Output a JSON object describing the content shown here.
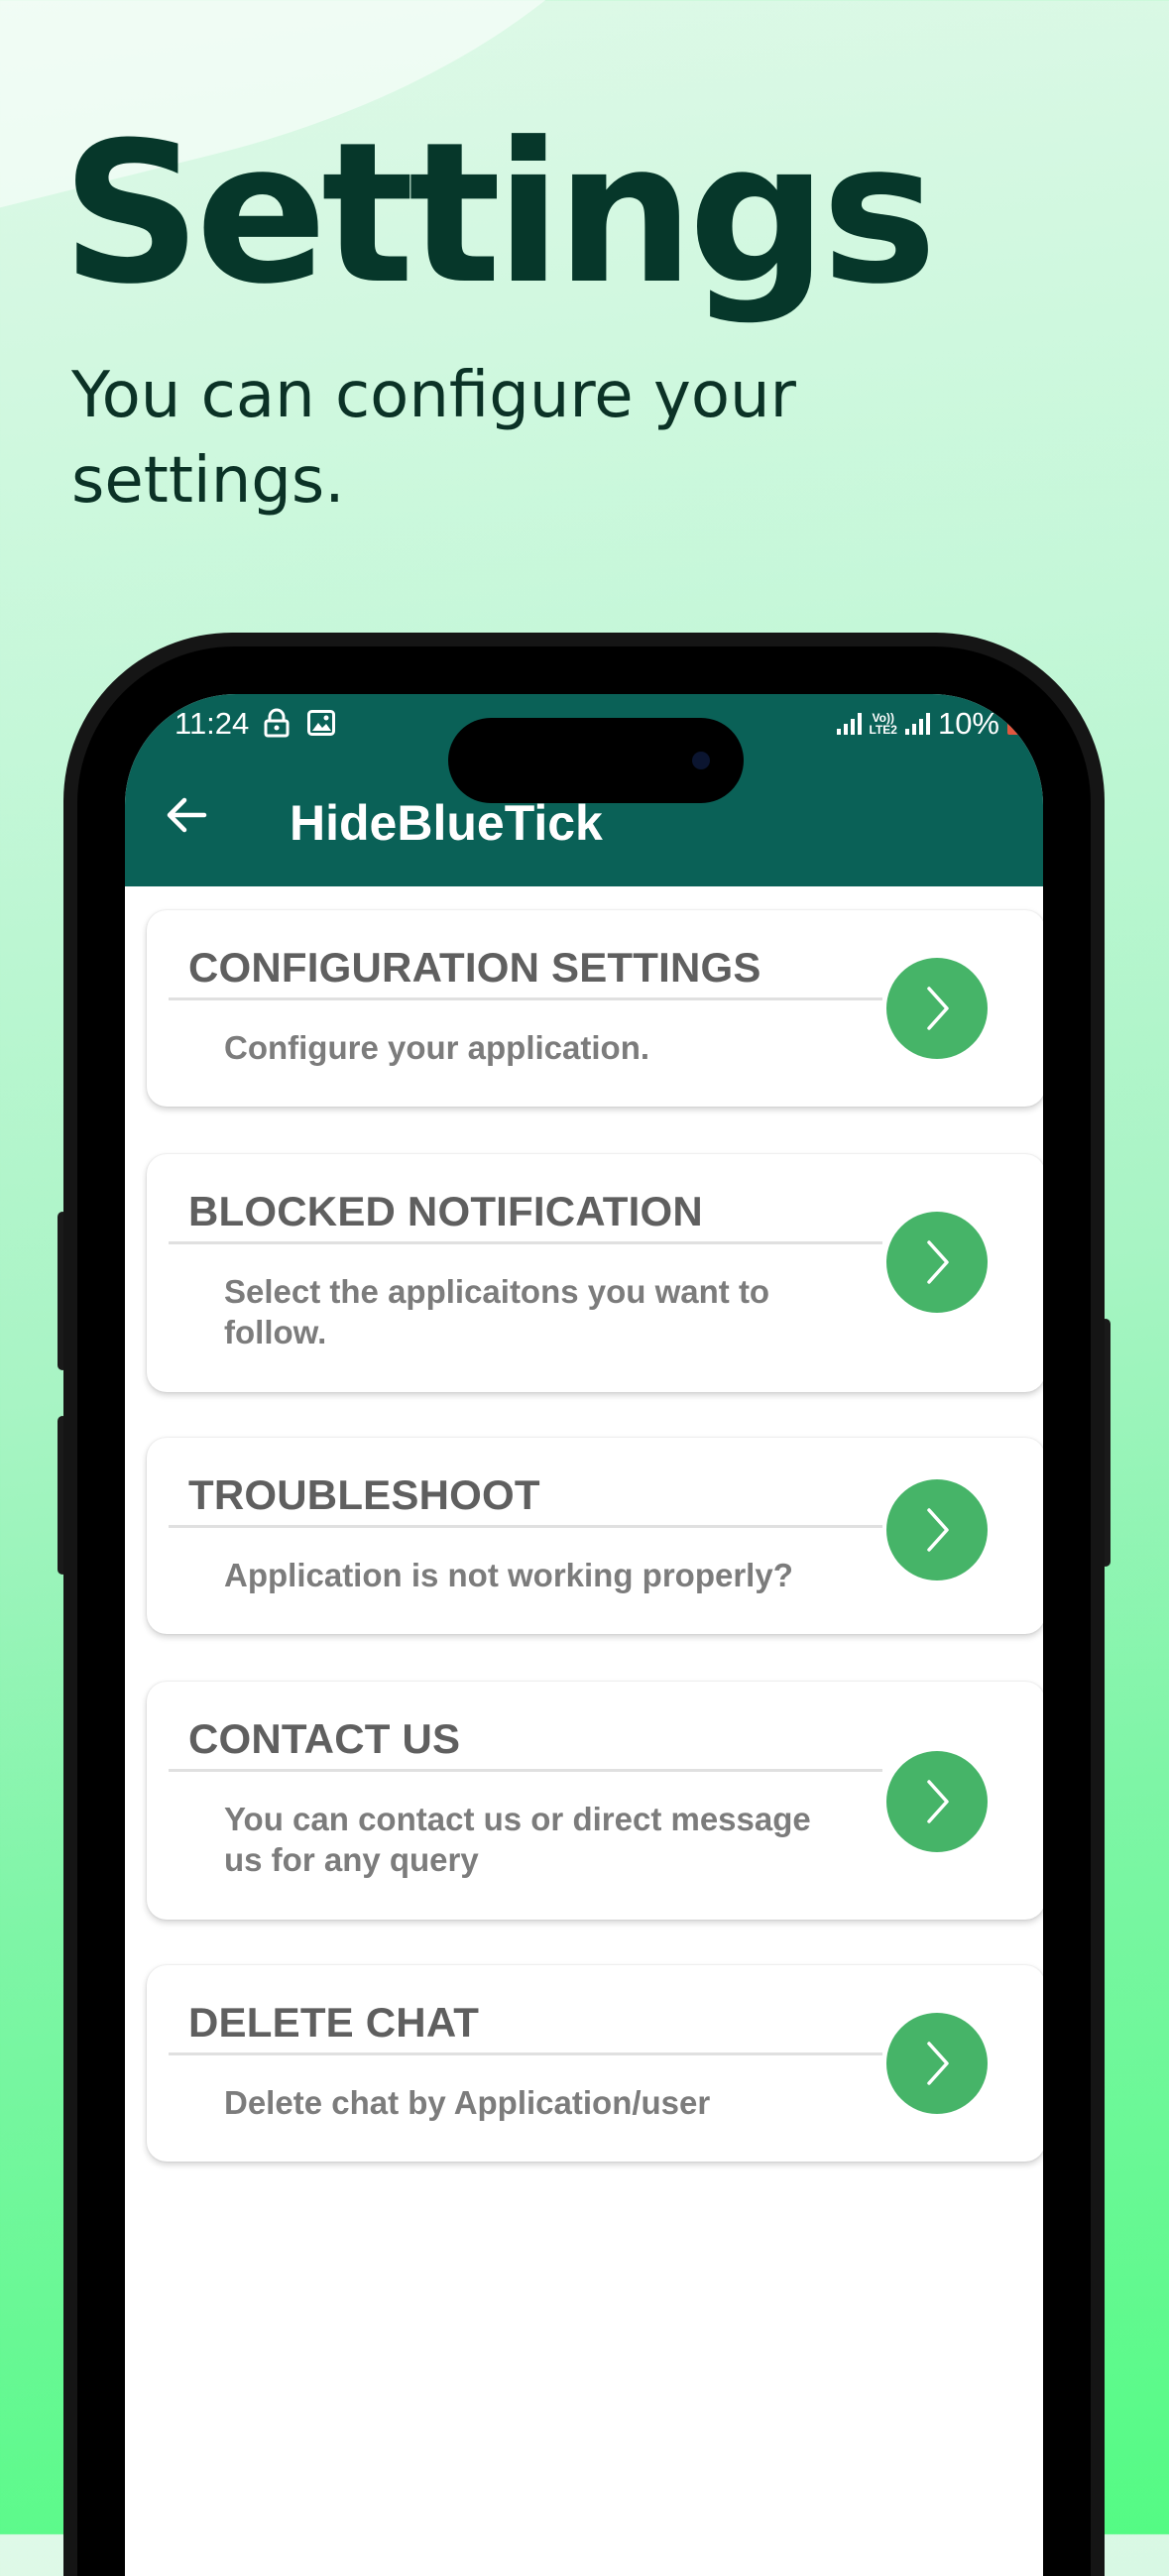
{
  "hero": {
    "title": "Settings",
    "subtitle": "You can configure your settings."
  },
  "status_bar": {
    "time": "11:24",
    "network_label_top": "Vo))",
    "network_label_bottom": "LTE2",
    "battery": "10%",
    "left_icons": [
      "lock-icon",
      "image-icon"
    ],
    "battery_color": "#e2573f"
  },
  "app_bar": {
    "title": "HideBlueTick",
    "back_icon": "arrow-left-icon",
    "color": "#0a6157"
  },
  "settings": {
    "accent_color": "#46b468",
    "items": [
      {
        "title": "CONFIGURATION SETTINGS",
        "description": "Configure your application.",
        "icon": "chevron-right-icon"
      },
      {
        "title": "BLOCKED NOTIFICATION",
        "description": "Select the applicaitons you want to follow.",
        "icon": "chevron-right-icon"
      },
      {
        "title": "TROUBLESHOOT",
        "description": "Application is not working properly?",
        "icon": "chevron-right-icon"
      },
      {
        "title": "CONTACT US",
        "description": "You can contact us or direct message us for any query",
        "icon": "chevron-right-icon"
      },
      {
        "title": "DELETE CHAT",
        "description": "Delete chat by Application/user",
        "icon": "chevron-right-icon"
      }
    ]
  }
}
